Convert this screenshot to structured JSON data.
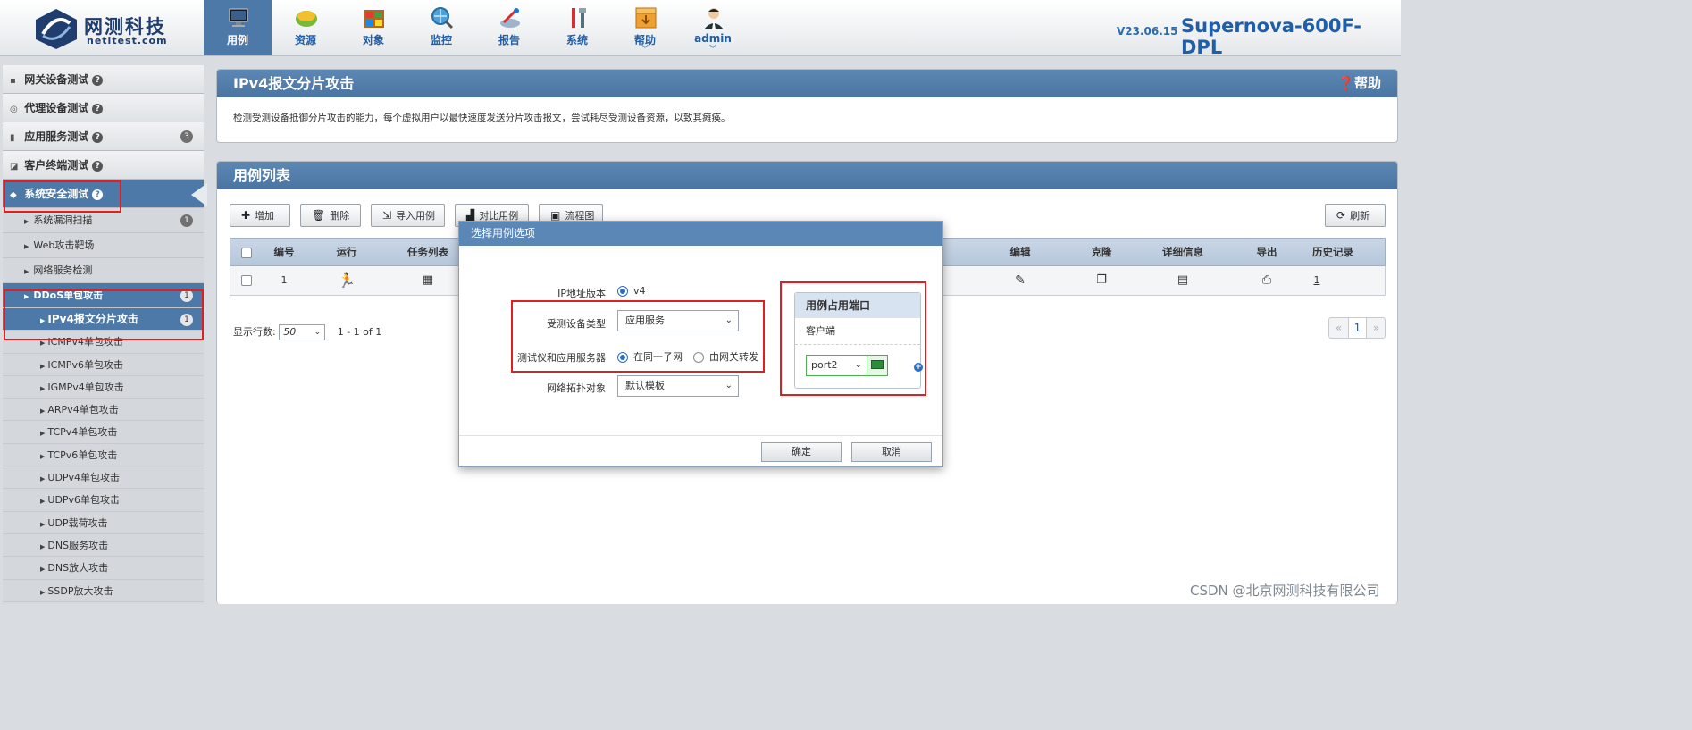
{
  "header": {
    "logo_text": "网测科技",
    "logo_sub": "netitest.com",
    "version": "V23.06.15",
    "product": "Supernova-600F-DPL",
    "nav": [
      {
        "label": "用例",
        "icon": "monitor-icon",
        "active": true,
        "caret": false
      },
      {
        "label": "资源",
        "icon": "resource-icon",
        "active": false,
        "caret": false
      },
      {
        "label": "对象",
        "icon": "object-icon",
        "active": false,
        "caret": false
      },
      {
        "label": "监控",
        "icon": "monitor-globe-icon",
        "active": false,
        "caret": false
      },
      {
        "label": "报告",
        "icon": "report-icon",
        "active": false,
        "caret": false
      },
      {
        "label": "系统",
        "icon": "tools-icon",
        "active": false,
        "caret": false
      },
      {
        "label": "帮助",
        "icon": "help-box-icon",
        "active": false,
        "caret": true
      },
      {
        "label": "admin",
        "icon": "user-icon",
        "active": false,
        "caret": true
      }
    ],
    "caret_glyph": "︾"
  },
  "sidebar": {
    "categories": [
      {
        "label": "网关设备测试",
        "icon": "gateway-icon",
        "glyph": "▪"
      },
      {
        "label": "代理设备测试",
        "icon": "proxy-icon",
        "glyph": "◎"
      },
      {
        "label": "应用服务测试",
        "icon": "server-icon",
        "glyph": "▮",
        "badge": "3"
      },
      {
        "label": "客户终端测试",
        "icon": "client-icon",
        "glyph": "◪"
      },
      {
        "label": "系统安全测试",
        "icon": "shield-icon",
        "glyph": "◆"
      }
    ],
    "qmark": "?",
    "subs": [
      {
        "label": "系统漏洞扫描",
        "badge": "1"
      },
      {
        "label": "Web攻击靶场"
      },
      {
        "label": "网络服务检测"
      },
      {
        "label": "DDoS单包攻击",
        "badge": "1"
      }
    ],
    "leaves": [
      {
        "label": "IPv4报文分片攻击",
        "badge": "1"
      },
      {
        "label": "ICMPv4单包攻击"
      },
      {
        "label": "ICMPv6单包攻击"
      },
      {
        "label": "IGMPv4单包攻击"
      },
      {
        "label": "ARPv4单包攻击"
      },
      {
        "label": "TCPv4单包攻击"
      },
      {
        "label": "TCPv6单包攻击"
      },
      {
        "label": "UDPv4单包攻击"
      },
      {
        "label": "UDPv6单包攻击"
      },
      {
        "label": "UDP载荷攻击"
      },
      {
        "label": "DNS服务攻击"
      },
      {
        "label": "DNS放大攻击"
      },
      {
        "label": "SSDP放大攻击"
      }
    ]
  },
  "info_panel": {
    "title": "IPv4报文分片攻击",
    "help": "❓帮助",
    "description": "检测受测设备抵御分片攻击的能力，每个虚拟用户以最快速度发送分片攻击报文，尝试耗尽受测设备资源，以致其瘫痪。"
  },
  "list_panel": {
    "title": "用例列表",
    "buttons": [
      {
        "label": "增加",
        "icon": "plus-icon",
        "glyph": "✚"
      },
      {
        "label": "删除",
        "icon": "trash-icon",
        "glyph": "🗑"
      },
      {
        "label": "导入用例",
        "icon": "import-icon",
        "glyph": "⇲"
      },
      {
        "label": "对比用例",
        "icon": "compare-icon",
        "glyph": "▟"
      },
      {
        "label": "流程图",
        "icon": "flowchart-icon",
        "glyph": "▣"
      }
    ],
    "refresh": "刷新",
    "columns": [
      "编号",
      "运行",
      "任务列表",
      "编辑",
      "克隆",
      "详细信息",
      "导出",
      "历史记录"
    ],
    "row": {
      "id": "1",
      "run_icon": "run-icon",
      "task_icon": "calendar-icon",
      "edit_icon": "pencil-icon",
      "clone_icon": "clone-icon",
      "detail_icon": "detail-icon",
      "export_icon": "export-icon",
      "history": "1"
    },
    "row_glyphs": {
      "run": "🏃",
      "task": "▦",
      "edit": "✎",
      "clone": "❐",
      "detail": "▤",
      "export": "⎙"
    },
    "rows_label": "显示行数:",
    "rows_value": "50",
    "range": "1 - 1 of 1",
    "pager": {
      "prev": "«",
      "page": "1",
      "next": "»"
    }
  },
  "modal": {
    "title": "选择用例选项",
    "ip_version_label": "IP地址版本",
    "ip_version_value": "v4",
    "dut_type_label": "受测设备类型",
    "dut_type_value": "应用服务",
    "tester_server_label": "测试仪和应用服务器",
    "option_same_subnet": "在同一子网",
    "option_gateway": "由网关转发",
    "topology_label": "网络拓扑对象",
    "topology_value": "默认模板",
    "port_panel_title": "用例占用端口",
    "port_client_label": "客户端",
    "port_value": "port2",
    "ok": "确定",
    "cancel": "取消"
  },
  "watermark": "CSDN @北京网测科技有限公司",
  "colors": {
    "accent": "#4d79a8",
    "highlight": "#e02020",
    "brand": "#1f5ea8"
  }
}
